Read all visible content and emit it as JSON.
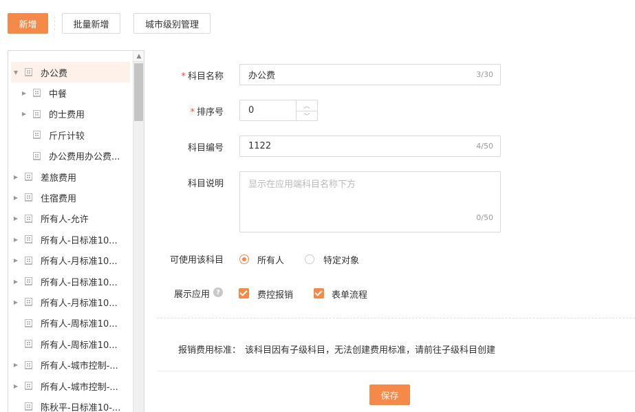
{
  "toolbar": {
    "add_label": "新增",
    "batch_add_label": "批量新增",
    "city_level_label": "城市级别管理"
  },
  "tree": {
    "items": [
      {
        "label": "办公费",
        "level": 0,
        "expanded": true,
        "has_children": true,
        "selected": true
      },
      {
        "label": "中餐",
        "level": 1,
        "has_children": true
      },
      {
        "label": "的士费用",
        "level": 1,
        "has_children": true
      },
      {
        "label": "斤斤计较",
        "level": 1,
        "has_children": false
      },
      {
        "label": "办公费用办公费...",
        "level": 1,
        "has_children": false
      },
      {
        "label": "差旅费用",
        "level": 0,
        "has_children": true
      },
      {
        "label": "住宿费用",
        "level": 0,
        "has_children": true
      },
      {
        "label": "所有人-允许",
        "level": 0,
        "has_children": true
      },
      {
        "label": "所有人-日标准10...",
        "level": 0,
        "has_children": true
      },
      {
        "label": "所有人-月标准10...",
        "level": 0,
        "has_children": true
      },
      {
        "label": "所有人-日标准10...",
        "level": 0,
        "has_children": true
      },
      {
        "label": "所有人-月标准10...",
        "level": 0,
        "has_children": true
      },
      {
        "label": "所有人-周标准10...",
        "level": 0,
        "has_children": false
      },
      {
        "label": "所有人-周标准10...",
        "level": 0,
        "has_children": false
      },
      {
        "label": "所有人-城市控制-...",
        "level": 0,
        "has_children": true
      },
      {
        "label": "所有人-城市控制-...",
        "level": 0,
        "has_children": true
      },
      {
        "label": "陈秋平-日标准10-...",
        "level": 0,
        "has_children": false
      }
    ]
  },
  "form": {
    "name": {
      "required": "*",
      "label": "科目名称",
      "value": "办公费",
      "counter": "3/30"
    },
    "order": {
      "required": "*",
      "label": "排序号",
      "value": "0"
    },
    "code": {
      "label": "科目编号",
      "value": "1122",
      "counter": "4/50"
    },
    "desc": {
      "label": "科目说明",
      "placeholder": "显示在应用端科目名称下方",
      "counter": "0/50"
    },
    "usable": {
      "label": "可使用该科目",
      "options": [
        "所有人",
        "特定对象"
      ],
      "selected": "所有人"
    },
    "display": {
      "label": "展示应用",
      "help": "?",
      "options": [
        "费控报销",
        "表单流程"
      ],
      "checked": [
        "费控报销",
        "表单流程"
      ]
    },
    "standard": {
      "label": "报销费用标准：",
      "text": "该科目因有子级科目，无法创建费用标准，请前往子级科目创建"
    },
    "save_label": "保存"
  },
  "colors": {
    "accent": "#f5894a",
    "required": "#f04a3c"
  }
}
